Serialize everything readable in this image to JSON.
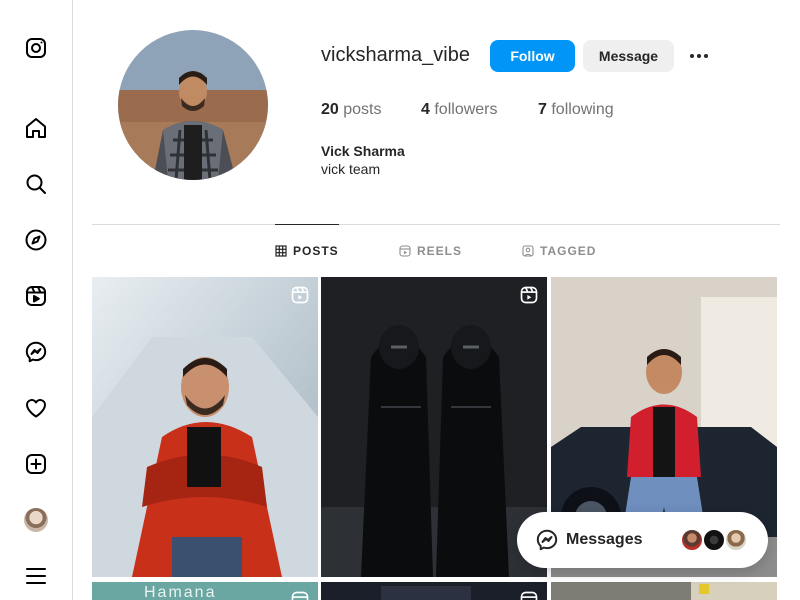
{
  "profile": {
    "username": "vicksharma_vibe",
    "follow_label": "Follow",
    "message_label": "Message",
    "more_icon": "more-horizontal-icon",
    "stats": {
      "posts_count": "20",
      "posts_label": "posts",
      "followers_count": "4",
      "followers_label": "followers",
      "following_count": "7",
      "following_label": "following"
    },
    "full_name": "Vick Sharma",
    "bio": "vick team"
  },
  "tabs": [
    {
      "label": "POSTS",
      "icon": "grid-icon",
      "active": true
    },
    {
      "label": "REELS",
      "icon": "reels-icon",
      "active": false
    },
    {
      "label": "TAGGED",
      "icon": "tagged-icon",
      "active": false
    }
  ],
  "sidebar": {
    "items": [
      {
        "name": "instagram-logo",
        "icon": "instagram-icon"
      },
      {
        "name": "home",
        "icon": "home-icon"
      },
      {
        "name": "search",
        "icon": "search-icon"
      },
      {
        "name": "explore",
        "icon": "compass-icon"
      },
      {
        "name": "reels",
        "icon": "reels-icon"
      },
      {
        "name": "messages",
        "icon": "messenger-icon"
      },
      {
        "name": "notifications",
        "icon": "heart-icon"
      },
      {
        "name": "create",
        "icon": "plus-square-icon"
      },
      {
        "name": "profile",
        "icon": "avatar"
      },
      {
        "name": "more",
        "icon": "menu-icon"
      }
    ]
  },
  "grid": {
    "posts": [
      {
        "type": "reel",
        "description": "man in red puffer jacket"
      },
      {
        "type": "reel",
        "description": "dark figures"
      },
      {
        "type": "post",
        "description": "man in red jacket by car"
      },
      {
        "type": "reel",
        "partial_text": "Hamana"
      },
      {
        "type": "reel",
        "description": "dark image"
      },
      {
        "type": "post",
        "description": "partial image"
      }
    ]
  },
  "messages_bar": {
    "label": "Messages",
    "icon": "messenger-icon"
  },
  "colors": {
    "accent": "#0095f6",
    "text": "#262626",
    "muted": "#737373",
    "border": "#dbdbdb"
  }
}
